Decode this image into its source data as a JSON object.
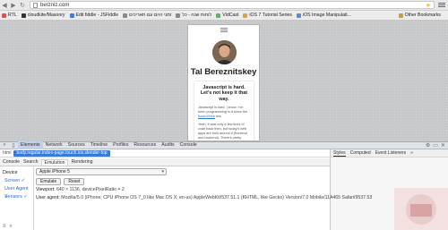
{
  "browser": {
    "url": "berzniz.com",
    "bookmarks": [
      {
        "label": "RTL",
        "color": "#d9534f"
      },
      {
        "label": "cloudkite/Masonry",
        "color": "#333333"
      },
      {
        "label": "Edit fiddle - JSFiddle",
        "color": "#3d7fd9"
      },
      {
        "label": "זמני היום עם תאריכים",
        "color": "#8a8a8a"
      },
      {
        "label": "לוחות שנה - כל",
        "color": "#8a8a8a"
      },
      {
        "label": "VidCast",
        "color": "#5cb85c"
      },
      {
        "label": "iOS 7 Tutorial Series",
        "color": "#e0a23b"
      },
      {
        "label": "iOS Image Manipulati...",
        "color": "#5b8ad6"
      }
    ],
    "other_bookmarks": "Other Bookmarks"
  },
  "page": {
    "name": "Tal Bereznitskey",
    "card_title": "Javascript is hard. Let's not keep it that way.",
    "card_p1_pre": "Javascript is hard. I know. I've been programming in it since the ",
    "card_p1_link": "BackUWeb",
    "card_p1_post": " era.",
    "card_p2": "Yeah, it was only a few lines of code back then, but today's web apps are built around it (frontend and backend). There's pretty heavy for a language that hides your entire"
  },
  "devtools": {
    "tabs": [
      "Elements",
      "Network",
      "Sources",
      "Timeline",
      "Profiles",
      "Resources",
      "Audits",
      "Console"
    ],
    "active_tab": "Elements",
    "crumbs": [
      "html",
      "body.regular.index-page.touch.ios.slender-top"
    ],
    "styles_tabs": [
      "Styles",
      "Computed",
      "Event Listeners",
      "»"
    ],
    "drawer_tabs": [
      "Console",
      "Search",
      "Emulation",
      "Rendering"
    ],
    "drawer_active": "Emulation",
    "side": {
      "head": "Device",
      "items": [
        "Screen ✓",
        "User Agent ✓",
        "Sensors ✓"
      ]
    },
    "device_select": "Apple iPhone 5",
    "emulate_btn": "Emulate",
    "reset_btn": "Reset",
    "viewport_key": "Viewport:",
    "viewport_val": "640 × 1136, devicePixelRatio = 2",
    "ua_key": "User agent:",
    "ua_val": "Mozilla/5.0 (iPhone; CPU iPhone OS 7_0 like Mac OS X; en-us) AppleWebKit/537.51.1 (KHTML, like Gecko) Version/7.0 Mobile/11A465 Safari/9537.53"
  }
}
